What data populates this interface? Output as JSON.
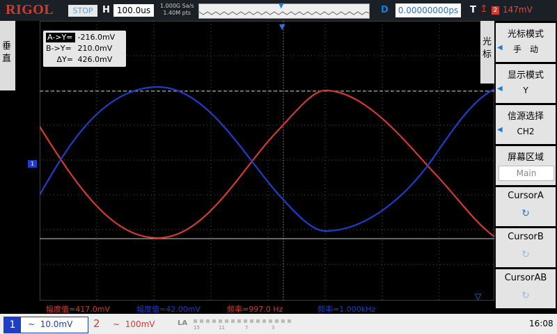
{
  "header": {
    "brand": "RIGOL",
    "run_status": "STOP",
    "horizontal_label": "H",
    "timebase": "100.0us",
    "sample_rate": "1.000G Sa/s",
    "memory_depth": "1.40M pts",
    "delay_label": "D",
    "delay": "0.00000000ps",
    "trigger_label": "T",
    "trigger_source": "2",
    "trigger_level": "147mV"
  },
  "left_tab": {
    "label": "垂直"
  },
  "cursor_readout": {
    "a_label": "A->Y=",
    "a_value": "-216.0mV",
    "b_label": "B->Y=",
    "b_value": "210.0mV",
    "d_label": "ΔY=",
    "d_value": "426.0mV"
  },
  "ch1_marker": "1",
  "right_tab": {
    "label": "光标"
  },
  "menu": {
    "items": [
      {
        "title": "光标模式",
        "value": "手　动",
        "type": "select"
      },
      {
        "title": "显示模式",
        "value": "Y",
        "type": "select"
      },
      {
        "title": "信源选择",
        "value": "CH2",
        "type": "select"
      },
      {
        "title": "屏幕区域",
        "value": "Main",
        "type": "field"
      },
      {
        "title": "CursorA",
        "type": "knob"
      },
      {
        "title": "CursorB",
        "type": "knob"
      },
      {
        "title": "CursorAB",
        "type": "knob"
      }
    ]
  },
  "measurements": [
    {
      "text": "幅度值=417.0mV",
      "color": "#d43b2e"
    },
    {
      "text": "幅度值=42.00mV",
      "color": "#1e3ec8"
    },
    {
      "text": "频率=997.0 Hz",
      "color": "#d43b2e"
    },
    {
      "text": "频率=1.000kHz",
      "color": "#1e3ec8"
    }
  ],
  "channels": [
    {
      "number": "1",
      "scale": "10.0mV",
      "coupling": "~",
      "color": "#1e3ec8"
    },
    {
      "number": "2",
      "scale": "100mV",
      "coupling": "~",
      "color": "#d43b2e"
    }
  ],
  "la": {
    "label": "LA",
    "nums": [
      "15",
      "11",
      "7",
      "3"
    ]
  },
  "clock": "16:08",
  "colors": {
    "ch1": "#1e3ec8",
    "ch2": "#d43b2e",
    "accent": "#1e7be0"
  }
}
